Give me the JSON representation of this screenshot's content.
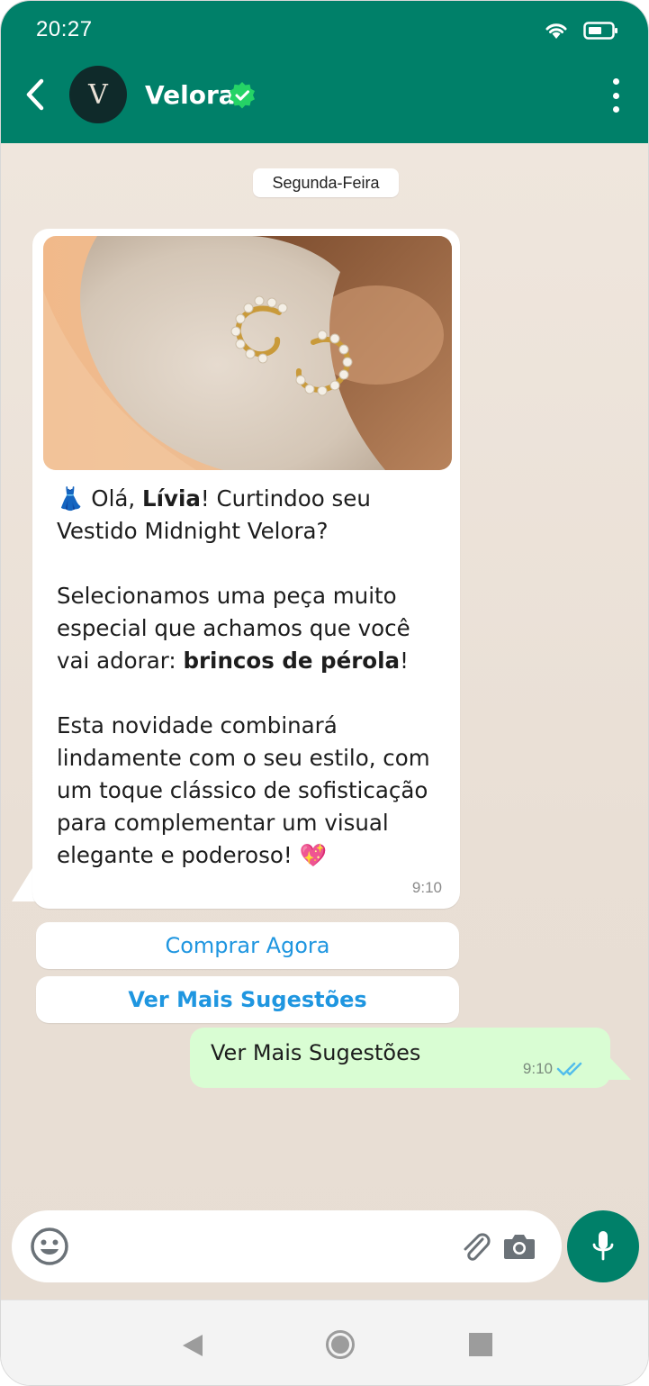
{
  "status_bar": {
    "time": "20:27"
  },
  "header": {
    "contact_name": "Velora",
    "avatar_letter": "V",
    "verified": true
  },
  "chat": {
    "date_label": "Segunda-Feira",
    "incoming": {
      "greeting_emoji": "👗",
      "line1_prefix": " Olá, ",
      "line1_name": "Lívia",
      "line1_suffix": "! Curtindoo seu Vestido Midnight Velora?",
      "para2_prefix": "Selecionamos uma peça muito especial que achamos que você vai adorar: ",
      "para2_bold": "brincos de pérola",
      "para2_suffix": "!",
      "para3": "Esta novidade combinará lindamente com o seu estilo, com um toque clássico de sofisticação para complementar um visual elegante e poderoso! ",
      "para3_emoji": "💖",
      "time": "9:10"
    },
    "quick_replies": [
      "Comprar Agora",
      "Ver Mais Sugestões"
    ],
    "outgoing": {
      "text": "Ver Mais Sugestões",
      "time": "9:10"
    }
  },
  "composer": {
    "placeholder": ""
  },
  "colors": {
    "header": "#008069",
    "outgoing_bubble": "#d9fdd3",
    "link_blue": "#1f96e0",
    "read_ticks": "#53bdeb"
  }
}
